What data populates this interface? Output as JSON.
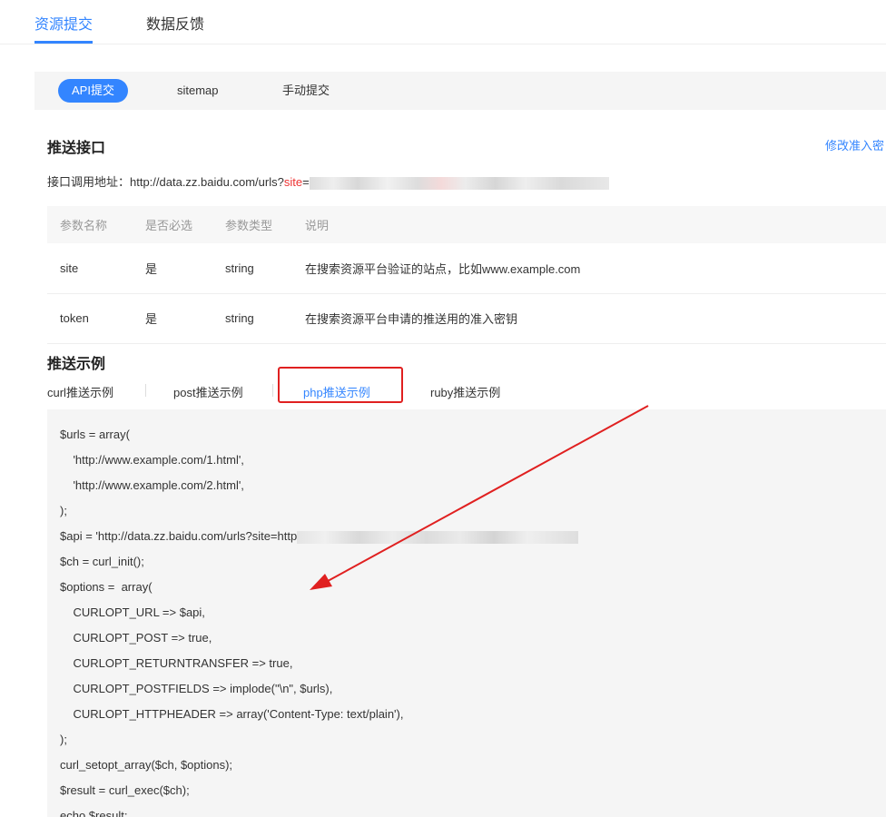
{
  "top_tabs": [
    "资源提交",
    "数据反馈"
  ],
  "subnav": [
    "API提交",
    "sitemap",
    "手动提交"
  ],
  "push_api": {
    "title": "推送接口",
    "modify_link": "修改准入密",
    "endpoint_label": "接口调用地址：http://data.zz.baidu.com/urls?",
    "endpoint_param": "site",
    "endpoint_eq": "="
  },
  "param_table": {
    "headers": [
      "参数名称",
      "是否必选",
      "参数类型",
      "说明"
    ],
    "rows": [
      [
        "site",
        "是",
        "string",
        "在搜索资源平台验证的站点，比如www.example.com"
      ],
      [
        "token",
        "是",
        "string",
        "在搜索资源平台申请的推送用的准入密钥"
      ]
    ]
  },
  "push_example": {
    "title": "推送示例",
    "tabs": [
      "curl推送示例",
      "post推送示例",
      "php推送示例",
      "ruby推送示例"
    ],
    "active_tab": "php推送示例"
  },
  "code": {
    "lines": [
      "$urls = array(",
      "    'http://www.example.com/1.html',",
      "    'http://www.example.com/2.html',",
      ");",
      "$api = 'http://data.zz.baidu.com/urls?site=http",
      "$ch = curl_init();",
      "$options =  array(",
      "    CURLOPT_URL => $api,",
      "    CURLOPT_POST => true,",
      "    CURLOPT_RETURNTRANSFER => true,",
      "    CURLOPT_POSTFIELDS => implode(\"\\n\", $urls),",
      "    CURLOPT_HTTPHEADER => array('Content-Type: text/plain'),",
      ");",
      "curl_setopt_array($ch, $options);",
      "$result = curl_exec($ch);",
      "echo $result;"
    ]
  },
  "colors": {
    "accent": "#3385ff",
    "annotation": "#e02020"
  }
}
